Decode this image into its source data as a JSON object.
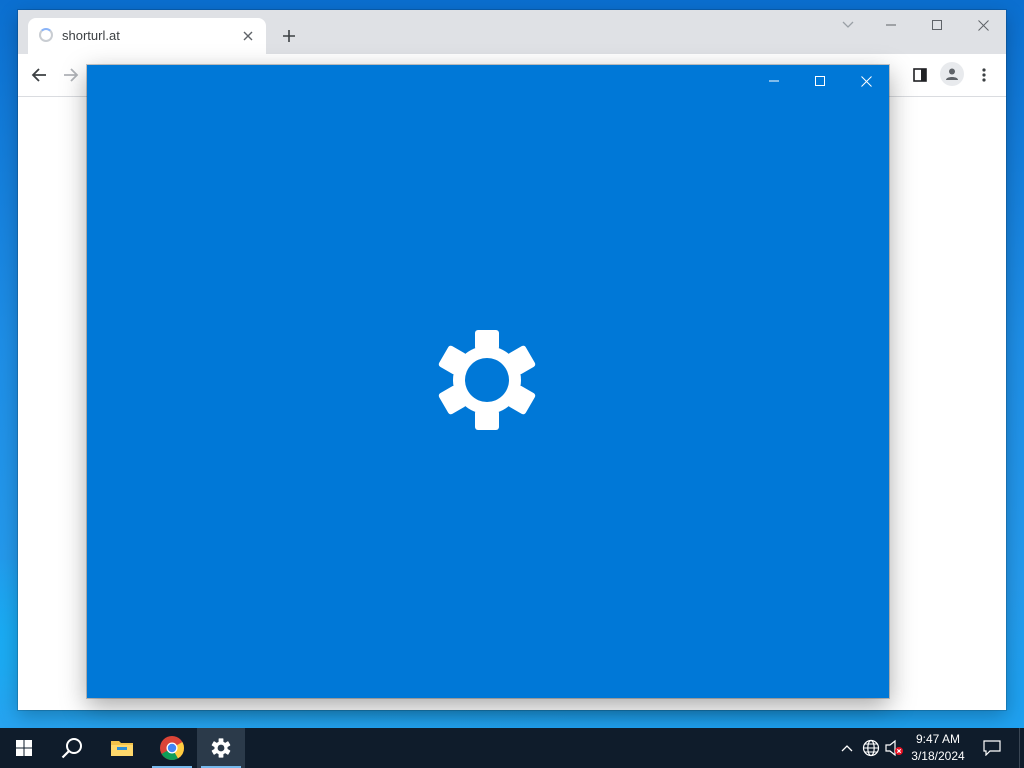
{
  "browser": {
    "tab": {
      "title": "shorturl.at",
      "status": "loading"
    },
    "icons": {
      "tab_close": "close-icon",
      "new_tab": "plus-icon",
      "back": "arrow-left-icon",
      "forward": "arrow-right-icon",
      "side_panel": "side-panel-icon",
      "profile": "person-icon",
      "menu": "kebab-menu-icon"
    }
  },
  "settings_window": {
    "background": "#0078d7",
    "splash_icon": "gear-icon"
  },
  "taskbar": {
    "items": [
      "windows-start-icon",
      "search-icon",
      "file-explorer-icon",
      "chrome-icon",
      "settings-icon"
    ],
    "clock": {
      "time": "9:47 AM",
      "date": "3/18/2024"
    },
    "tray": [
      "chevron-up-icon",
      "network-globe-icon",
      "volume-muted-icon",
      "action-center-icon"
    ]
  }
}
